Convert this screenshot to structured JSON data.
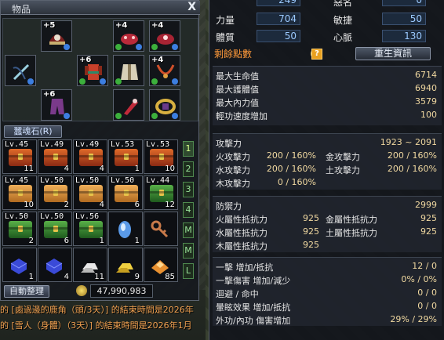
{
  "inventory": {
    "title": "物品",
    "close": "X",
    "equip_slots": [
      {
        "plus": "+5",
        "icon": "helmet-icon"
      },
      {
        "plus": "+4",
        "icon": "bracer-icon"
      },
      {
        "plus": "+4",
        "icon": "gauntlet-icon"
      },
      {
        "plus": "",
        "icon": "bow-icon"
      },
      {
        "plus": "+6",
        "icon": "armor-icon"
      },
      {
        "plus": "",
        "icon": "robe-icon"
      },
      {
        "plus": "+4",
        "icon": "necklace-icon"
      },
      {
        "plus": "+6",
        "icon": "pants-icon"
      },
      {
        "plus": "",
        "icon": "shoulder-icon"
      },
      {
        "plus": "",
        "icon": "belt-icon"
      }
    ],
    "tab_label": "蠶魂石(R)",
    "items": [
      {
        "lv": "Lv.45",
        "count": "11",
        "kind": "r"
      },
      {
        "lv": "Lv.49",
        "count": "4",
        "kind": "r"
      },
      {
        "lv": "Lv.49",
        "count": "4",
        "kind": "r"
      },
      {
        "lv": "Lv.53",
        "count": "1",
        "kind": "r"
      },
      {
        "lv": "Lv.53",
        "count": "10",
        "kind": "r"
      },
      {
        "lv": "Lv.45",
        "count": "10",
        "kind": "o"
      },
      {
        "lv": "Lv.50",
        "count": "2",
        "kind": "o"
      },
      {
        "lv": "Lv.50",
        "count": "4",
        "kind": "o"
      },
      {
        "lv": "Lv.50",
        "count": "6",
        "kind": "o"
      },
      {
        "lv": "Lv.44",
        "count": "12",
        "kind": "g"
      },
      {
        "lv": "Lv.50",
        "count": "2",
        "kind": "g"
      },
      {
        "lv": "Lv.50",
        "count": "6",
        "kind": "g"
      },
      {
        "lv": "Lv.56",
        "count": "1",
        "kind": "g"
      },
      {
        "lv": "",
        "count": "1",
        "kind": "orb"
      },
      {
        "lv": "",
        "count": "",
        "kind": "key"
      },
      {
        "lv": "",
        "count": "1",
        "kind": "cloth-blue"
      },
      {
        "lv": "",
        "count": "4",
        "kind": "cloth-blue"
      },
      {
        "lv": "",
        "count": "11",
        "kind": "ingot-silver"
      },
      {
        "lv": "",
        "count": "9",
        "kind": "ingot-gold"
      },
      {
        "lv": "",
        "count": "85",
        "kind": "ore"
      }
    ],
    "pages": [
      "1",
      "2",
      "3",
      "4",
      "M",
      "M",
      "L"
    ],
    "sort_label": "自動整理",
    "money": "47,990,983"
  },
  "chat": [
    "的 [鹵過邊的鹿角（頭/3天）] 的結束時間是2026年",
    "的 [雪人（身體）（3天）] 的結束時間是2026年1月"
  ],
  "stats": {
    "top": [
      {
        "label": "力量",
        "value": "704",
        "label2": "敏捷",
        "value2": "50"
      },
      {
        "label": "體質",
        "value": "50",
        "label2": "心脈",
        "value2": "130"
      }
    ],
    "top_partial": {
      "value": "249",
      "label2": "惡名",
      "value2": "0"
    },
    "remain_label": "剩餘點數",
    "remain_value": "0",
    "reset_label": "重生資訊",
    "basic": [
      {
        "label": "最大生命值",
        "value": "6714"
      },
      {
        "label": "最大護體值",
        "value": "6940"
      },
      {
        "label": "最大內力值",
        "value": "3579"
      },
      {
        "label": "輕功速度增加",
        "value": "100"
      }
    ],
    "attack": {
      "label": "攻擊力",
      "value": "1923 ~ 2091",
      "elements": [
        {
          "l1": "火攻擊力",
          "v1": "200 / 160%",
          "l2": "金攻擊力",
          "v2": "200 / 160%"
        },
        {
          "l1": "水攻擊力",
          "v1": "200 / 160%",
          "l2": "土攻擊力",
          "v2": "200 / 160%"
        },
        {
          "l1": "木攻擊力",
          "v1": "0 / 160%",
          "l2": "",
          "v2": ""
        }
      ]
    },
    "defense": {
      "label": "防禦力",
      "value": "2999",
      "elements": [
        {
          "l1": "火屬性抵抗力",
          "v1": "925",
          "l2": "金屬性抵抗力",
          "v2": "925"
        },
        {
          "l1": "水屬性抵抗力",
          "v1": "925",
          "l2": "土屬性抵抗力",
          "v2": "925"
        },
        {
          "l1": "木屬性抵抗力",
          "v1": "925",
          "l2": "",
          "v2": ""
        }
      ]
    },
    "misc": [
      {
        "label": "一擊 增加/抵抗",
        "value": "12 / 0"
      },
      {
        "label": "一擊傷害 增加/減少",
        "value": "0% / 0%"
      },
      {
        "label": "迴避 / 命中",
        "value": "0 / 0"
      },
      {
        "label": "暈眩效果 增加/抵抗",
        "value": "0 / 0"
      },
      {
        "label": "外功/內功 傷害增加",
        "value": "29% / 29%"
      }
    ]
  }
}
